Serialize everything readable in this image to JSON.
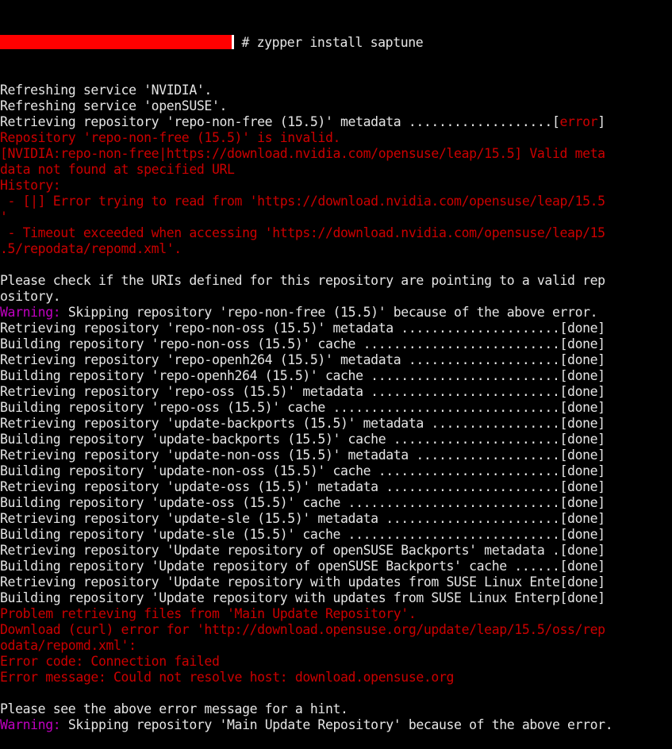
{
  "colors": {
    "background": "#000000",
    "normal": "#e5e5e5",
    "error": "#cc0000",
    "warning": "#c000c0",
    "redaction": "#ff0000"
  },
  "prompt": {
    "redacted_user_host": "",
    "command": " # zypper install saptune"
  },
  "lines": [
    [
      {
        "t": "Refreshing service 'NVIDIA'.",
        "c": "normal"
      }
    ],
    [
      {
        "t": "Refreshing service 'openSUSE'.",
        "c": "normal"
      }
    ],
    [
      {
        "t": "Retrieving repository 'repo-non-free (15.5)' metadata ...................[",
        "c": "normal"
      },
      {
        "t": "error",
        "c": "red"
      },
      {
        "t": "]",
        "c": "normal"
      }
    ],
    [
      {
        "t": "Repository 'repo-non-free (15.5)' is invalid.",
        "c": "red"
      }
    ],
    [
      {
        "t": "[NVIDIA:repo-non-free|https://download.nvidia.com/opensuse/leap/15.5] Valid meta",
        "c": "red"
      }
    ],
    [
      {
        "t": "data not found at specified URL",
        "c": "red"
      }
    ],
    [
      {
        "t": "History:",
        "c": "red"
      }
    ],
    [
      {
        "t": " - [|] Error trying to read from 'https://download.nvidia.com/opensuse/leap/15.5",
        "c": "red"
      }
    ],
    [
      {
        "t": "'",
        "c": "red"
      }
    ],
    [
      {
        "t": " - Timeout exceeded when accessing 'https://download.nvidia.com/opensuse/leap/15",
        "c": "red"
      }
    ],
    [
      {
        "t": ".5/repodata/repomd.xml'.",
        "c": "red"
      }
    ],
    [
      {
        "t": "",
        "c": "normal"
      }
    ],
    [
      {
        "t": "Please check if the URIs defined for this repository are pointing to a valid rep",
        "c": "normal"
      }
    ],
    [
      {
        "t": "ository.",
        "c": "normal"
      }
    ],
    [
      {
        "t": "Warning:",
        "c": "magenta"
      },
      {
        "t": " Skipping repository 'repo-non-free (15.5)' because of the above error.",
        "c": "normal"
      }
    ],
    [
      {
        "t": "Retrieving repository 'repo-non-oss (15.5)' metadata .....................[done]",
        "c": "normal"
      }
    ],
    [
      {
        "t": "Building repository 'repo-non-oss (15.5)' cache ..........................[done]",
        "c": "normal"
      }
    ],
    [
      {
        "t": "Retrieving repository 'repo-openh264 (15.5)' metadata ....................[done]",
        "c": "normal"
      }
    ],
    [
      {
        "t": "Building repository 'repo-openh264 (15.5)' cache .........................[done]",
        "c": "normal"
      }
    ],
    [
      {
        "t": "Retrieving repository 'repo-oss (15.5)' metadata .........................[done]",
        "c": "normal"
      }
    ],
    [
      {
        "t": "Building repository 'repo-oss (15.5)' cache ..............................[done]",
        "c": "normal"
      }
    ],
    [
      {
        "t": "Retrieving repository 'update-backports (15.5)' metadata .................[done]",
        "c": "normal"
      }
    ],
    [
      {
        "t": "Building repository 'update-backports (15.5)' cache ......................[done]",
        "c": "normal"
      }
    ],
    [
      {
        "t": "Retrieving repository 'update-non-oss (15.5)' metadata ...................[done]",
        "c": "normal"
      }
    ],
    [
      {
        "t": "Building repository 'update-non-oss (15.5)' cache ........................[done]",
        "c": "normal"
      }
    ],
    [
      {
        "t": "Retrieving repository 'update-oss (15.5)' metadata .......................[done]",
        "c": "normal"
      }
    ],
    [
      {
        "t": "Building repository 'update-oss (15.5)' cache ............................[done]",
        "c": "normal"
      }
    ],
    [
      {
        "t": "Retrieving repository 'update-sle (15.5)' metadata .......................[done]",
        "c": "normal"
      }
    ],
    [
      {
        "t": "Building repository 'update-sle (15.5)' cache ............................[done]",
        "c": "normal"
      }
    ],
    [
      {
        "t": "Retrieving repository 'Update repository of openSUSE Backports' metadata .[done]",
        "c": "normal"
      }
    ],
    [
      {
        "t": "Building repository 'Update repository of openSUSE Backports' cache ......[done]",
        "c": "normal"
      }
    ],
    [
      {
        "t": "Retrieving repository 'Update repository with updates from SUSE Linux Ente[done]",
        "c": "normal"
      }
    ],
    [
      {
        "t": "Building repository 'Update repository with updates from SUSE Linux Enterp[done]",
        "c": "normal"
      }
    ],
    [
      {
        "t": "Problem retrieving files from 'Main Update Repository'.",
        "c": "red"
      }
    ],
    [
      {
        "t": "Download (curl) error for 'http://download.opensuse.org/update/leap/15.5/oss/rep",
        "c": "red"
      }
    ],
    [
      {
        "t": "odata/repomd.xml':",
        "c": "red"
      }
    ],
    [
      {
        "t": "Error code: Connection failed",
        "c": "red"
      }
    ],
    [
      {
        "t": "Error message: Could not resolve host: download.opensuse.org",
        "c": "red"
      }
    ],
    [
      {
        "t": "",
        "c": "normal"
      }
    ],
    [
      {
        "t": "Please see the above error message for a hint.",
        "c": "normal"
      }
    ],
    [
      {
        "t": "Warning:",
        "c": "magenta"
      },
      {
        "t": " Skipping repository 'Main Update Repository' because of the above error.",
        "c": "normal"
      }
    ]
  ]
}
